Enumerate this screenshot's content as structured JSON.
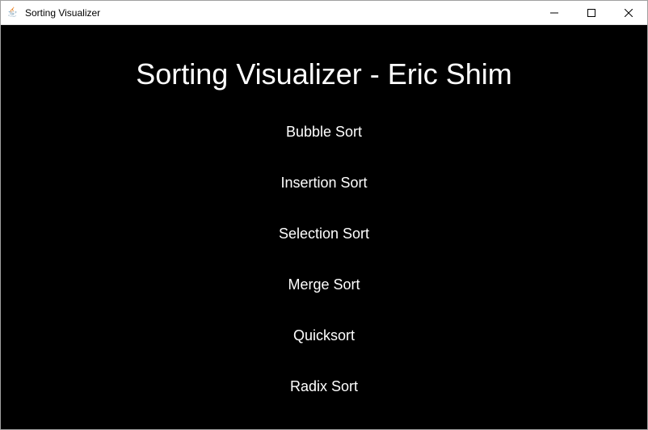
{
  "window": {
    "title": "Sorting Visualizer"
  },
  "main": {
    "heading": "Sorting Visualizer - Eric Shim",
    "options": [
      "Bubble Sort",
      "Insertion Sort",
      "Selection Sort",
      "Merge Sort",
      "Quicksort",
      "Radix Sort"
    ]
  }
}
